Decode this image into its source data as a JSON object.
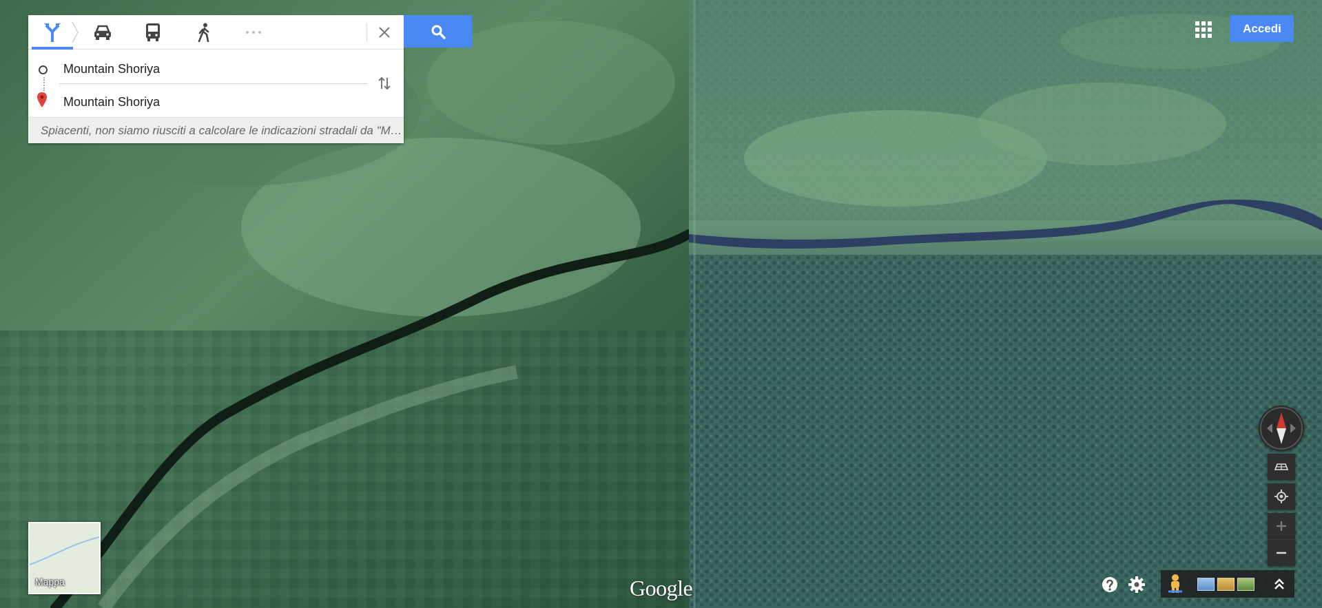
{
  "directions": {
    "modes": [
      {
        "id": "best",
        "icon": "directions-fork-icon",
        "active": true
      },
      {
        "id": "driving",
        "icon": "car-icon",
        "active": false
      },
      {
        "id": "transit",
        "icon": "bus-icon",
        "active": false
      },
      {
        "id": "walking",
        "icon": "walking-icon",
        "active": false
      },
      {
        "id": "more",
        "icon": "more-dots-icon",
        "active": false
      }
    ],
    "origin": "Mountain Shoriya",
    "destination": "Mountain Shoriya",
    "error_message": "Spiacenti, non siamo riusciti a calcolare le indicazioni stradali da \"Mountain Shoriya\" a \"Mountain Shoriya\""
  },
  "header": {
    "signin_label": "Accedi",
    "apps_icon": "apps-grid-icon"
  },
  "minimap": {
    "label": "Mappa"
  },
  "branding": {
    "logo_text": "Google"
  },
  "colors": {
    "accent": "#4a89f3",
    "river": "#2d3f63",
    "compass_north": "#d33a2f"
  }
}
